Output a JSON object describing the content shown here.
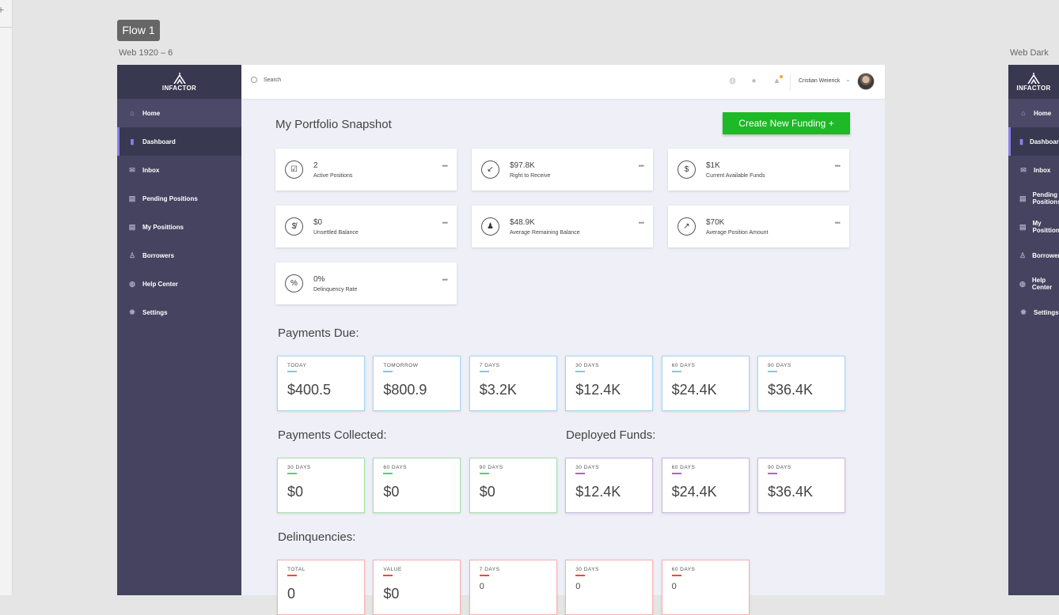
{
  "canvas": {
    "flow_badge": "Flow 1",
    "artboard_1": "Web 1920 – 6",
    "artboard_2": "Web Dark"
  },
  "sidebar": {
    "logo": "INFACTOR",
    "items": [
      {
        "label": "Home",
        "icon": "home-icon"
      },
      {
        "label": "Dashboard",
        "icon": "bar-chart-icon"
      },
      {
        "label": "Inbox",
        "icon": "mail-icon"
      },
      {
        "label": "Pending Positions",
        "icon": "document-icon"
      },
      {
        "label": "My Posittions",
        "icon": "document-icon"
      },
      {
        "label": "Borrowers",
        "icon": "user-icon"
      },
      {
        "label": "Help Center",
        "icon": "globe-icon"
      },
      {
        "label": "Settings",
        "icon": "gear-icon"
      }
    ],
    "active": "Dashboard"
  },
  "header": {
    "search_placeholder": "Search",
    "user_name": "Cristian Weierick"
  },
  "main": {
    "title": "My Portfolio Snapshot",
    "create_button": "Create New Funding +",
    "snapshot": [
      {
        "value": "2",
        "label": "Active Positions",
        "icon": "checkbox-icon"
      },
      {
        "value": "$97.8K",
        "label": "Right to Receive",
        "icon": "arrow-down-left-icon"
      },
      {
        "value": "$1K",
        "label": "Current Available Funds",
        "icon": "dollar-coin-icon"
      },
      {
        "value": "$0",
        "label": "Unsettled Balance",
        "icon": "no-dollar-icon"
      },
      {
        "value": "$48.9K",
        "label": "Average Remaining Balance",
        "icon": "money-bag-icon"
      },
      {
        "value": "$70K",
        "label": "Average Position Amount",
        "icon": "trend-up-icon"
      },
      {
        "value": "0%",
        "label": "Delinquency Rate",
        "icon": "percent-icon"
      }
    ],
    "payments_due": {
      "title": "Payments Due:",
      "items": [
        {
          "label": "TODAY",
          "value": "$400.5"
        },
        {
          "label": "TOMORROW",
          "value": "$800.9"
        },
        {
          "label": "7 DAYS",
          "value": "$3.2K"
        },
        {
          "label": "30 DAYS",
          "value": "$12.4K"
        },
        {
          "label": "60 DAYS",
          "value": "$24.4K"
        },
        {
          "label": "90 DAYS",
          "value": "$36.4K"
        }
      ]
    },
    "payments_collected": {
      "title": "Payments Collected:",
      "items": [
        {
          "label": "30 DAYS",
          "value": "$0"
        },
        {
          "label": "60 DAYS",
          "value": "$0"
        },
        {
          "label": "90 DAYS",
          "value": "$0"
        }
      ]
    },
    "deployed_funds": {
      "title": "Deployed Funds:",
      "items": [
        {
          "label": "30 DAYS",
          "value": "$12.4K"
        },
        {
          "label": "60 DAYS",
          "value": "$24.4K"
        },
        {
          "label": "90 DAYS",
          "value": "$36.4K"
        }
      ]
    },
    "delinquencies": {
      "title": "Delinquencies:",
      "items": [
        {
          "label": "TOTAL",
          "value": "0"
        },
        {
          "label": "VALUE",
          "value": "$0"
        },
        {
          "label": "7 DAYS",
          "value": "0"
        },
        {
          "label": "30 DAYS",
          "value": "0"
        },
        {
          "label": "60 DAYS",
          "value": "0"
        }
      ]
    }
  },
  "colors": {
    "sidebar": "#45435f",
    "accent": "#8b7fe8",
    "create": "#1db926",
    "due": "#a8d4f5",
    "collected": "#a6e0a9",
    "deployed": "#cdb7e0",
    "delinquent": "#f5b2b2"
  }
}
